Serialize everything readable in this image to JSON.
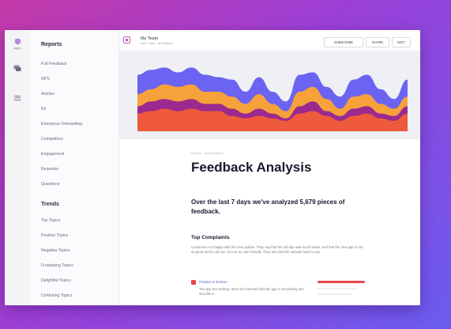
{
  "rail": [
    {
      "icon": "shield-icon",
      "label": "Apps"
    },
    {
      "icon": "chat-icon",
      "label": ""
    },
    {
      "icon": "people-icon",
      "label": ""
    }
  ],
  "sidebar": {
    "reports_heading": "Reports",
    "reports": [
      "Full Feedback",
      "NPS",
      "Articles",
      "Kit",
      "Enterprise Onboarding",
      "Competitors",
      "Engagement",
      "Requests",
      "Questions"
    ],
    "trends_heading": "Trends",
    "trends": [
      "Top Topics",
      "Positive Topics",
      "Negative Topics",
      "Frustrating Topics",
      "Delightful Topics",
      "Confusing Topics"
    ]
  },
  "topbar": {
    "title": "My Team",
    "subtitle": "Last 7 days · all feedback",
    "buttons": [
      "SUBSCRIBE",
      "SHARE",
      "EDIT"
    ]
  },
  "chart_data": {
    "type": "area",
    "x": [
      0,
      1,
      2,
      3,
      4,
      5,
      6,
      7,
      8,
      9,
      10,
      11,
      12,
      13,
      14,
      15,
      16,
      17,
      18,
      19,
      20
    ],
    "series": [
      {
        "values": [
          6,
          7,
          8,
          7,
          8,
          7,
          7,
          5,
          4,
          5,
          4,
          3,
          6,
          7,
          5,
          3,
          5,
          6,
          4,
          3,
          6
        ]
      },
      {
        "values": [
          9,
          11,
          12,
          11,
          12,
          10,
          10,
          8,
          6,
          8,
          6,
          4,
          9,
          11,
          7,
          5,
          8,
          9,
          6,
          5,
          9
        ]
      },
      {
        "values": [
          14,
          16,
          18,
          17,
          18,
          15,
          15,
          13,
          10,
          14,
          10,
          7,
          15,
          17,
          12,
          8,
          13,
          14,
          10,
          8,
          13
        ]
      },
      {
        "values": [
          22,
          24,
          25,
          23,
          25,
          22,
          21,
          20,
          15,
          21,
          15,
          11,
          22,
          23,
          17,
          13,
          20,
          22,
          16,
          12,
          20
        ]
      }
    ],
    "colors": [
      "#ef5a3c",
      "#9a2a8e",
      "#f6a13a",
      "#6b63f2"
    ],
    "background_band": "#eef0f5",
    "ylim": [
      0,
      30
    ]
  },
  "article": {
    "breadcrumb": "Reports · Full Feedback",
    "title": "Feedback Analysis",
    "lead": "Over the last 7 days we've analyzed 5,679 pieces of feedback.",
    "section_title": "Top Complaints",
    "section_body": "Customers not happy with the new update. They say that the old app was much better, and that the new app is not as good as the old one. It's not as user friendly. They also find the website hard to use.",
    "complaint": {
      "title": "Product is broken",
      "body": "The app isn't working, there are frustrated that the app is not working and describe it",
      "share": 1.0
    }
  },
  "colors": {
    "accent": "#6b63f2",
    "danger": "#e8474a",
    "text": "#1a1a2e"
  }
}
